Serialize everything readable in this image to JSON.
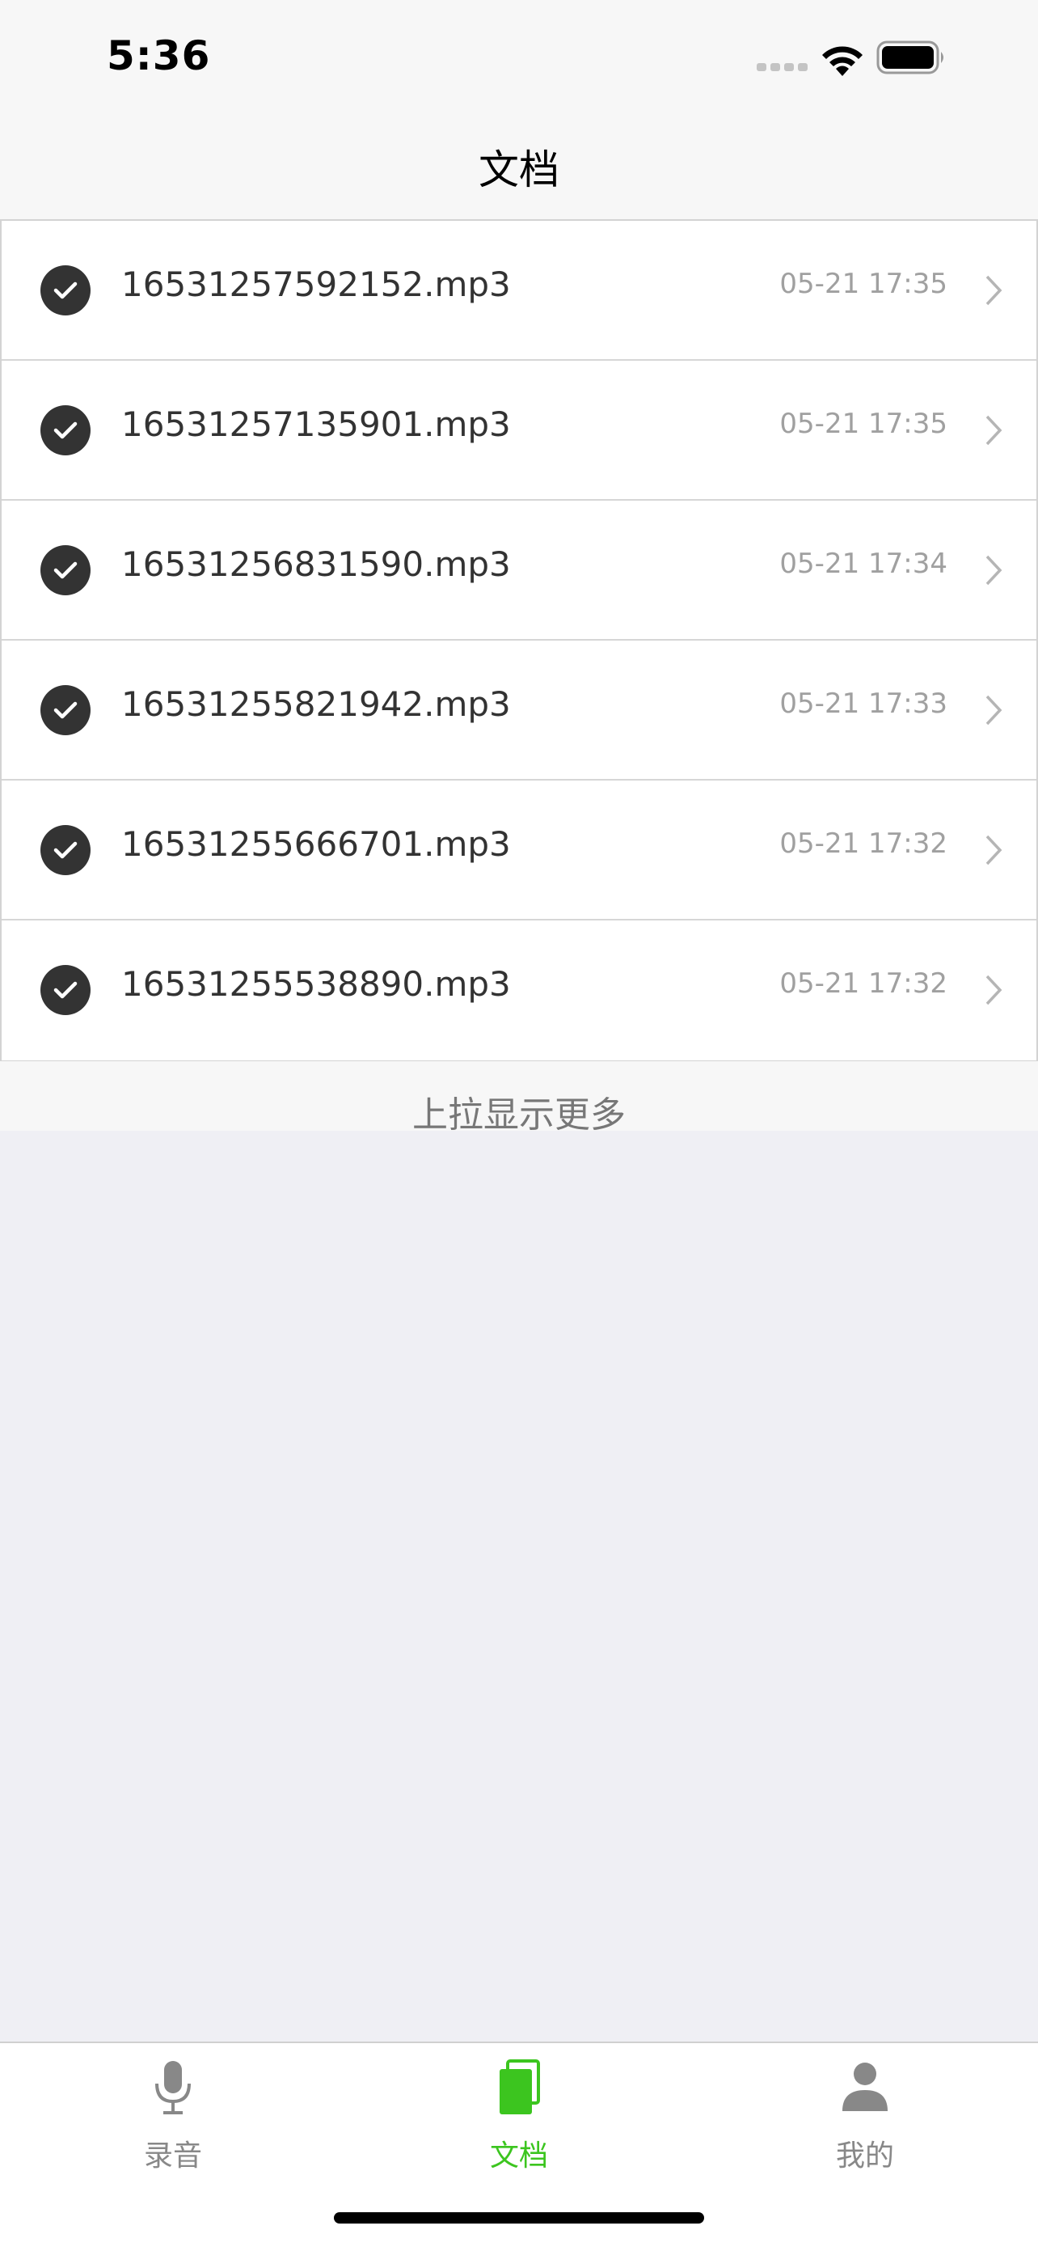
{
  "status_bar": {
    "time": "5:36"
  },
  "nav": {
    "title": "文档"
  },
  "files": [
    {
      "name": "16531257592152.mp3",
      "time": "05-21 17:35"
    },
    {
      "name": "16531257135901.mp3",
      "time": "05-21 17:35"
    },
    {
      "name": "16531256831590.mp3",
      "time": "05-21 17:34"
    },
    {
      "name": "16531255821942.mp3",
      "time": "05-21 17:33"
    },
    {
      "name": "16531255666701.mp3",
      "time": "05-21 17:32"
    },
    {
      "name": "16531255538890.mp3",
      "time": "05-21 17:32"
    }
  ],
  "load_more": "上拉显示更多",
  "tabs": [
    {
      "label": "录音",
      "icon": "microphone-icon"
    },
    {
      "label": "文档",
      "icon": "document-icon"
    },
    {
      "label": "我的",
      "icon": "person-icon"
    }
  ],
  "colors": {
    "accent": "#3cc51f",
    "check_bg": "#333333",
    "background": "#efeff4"
  }
}
